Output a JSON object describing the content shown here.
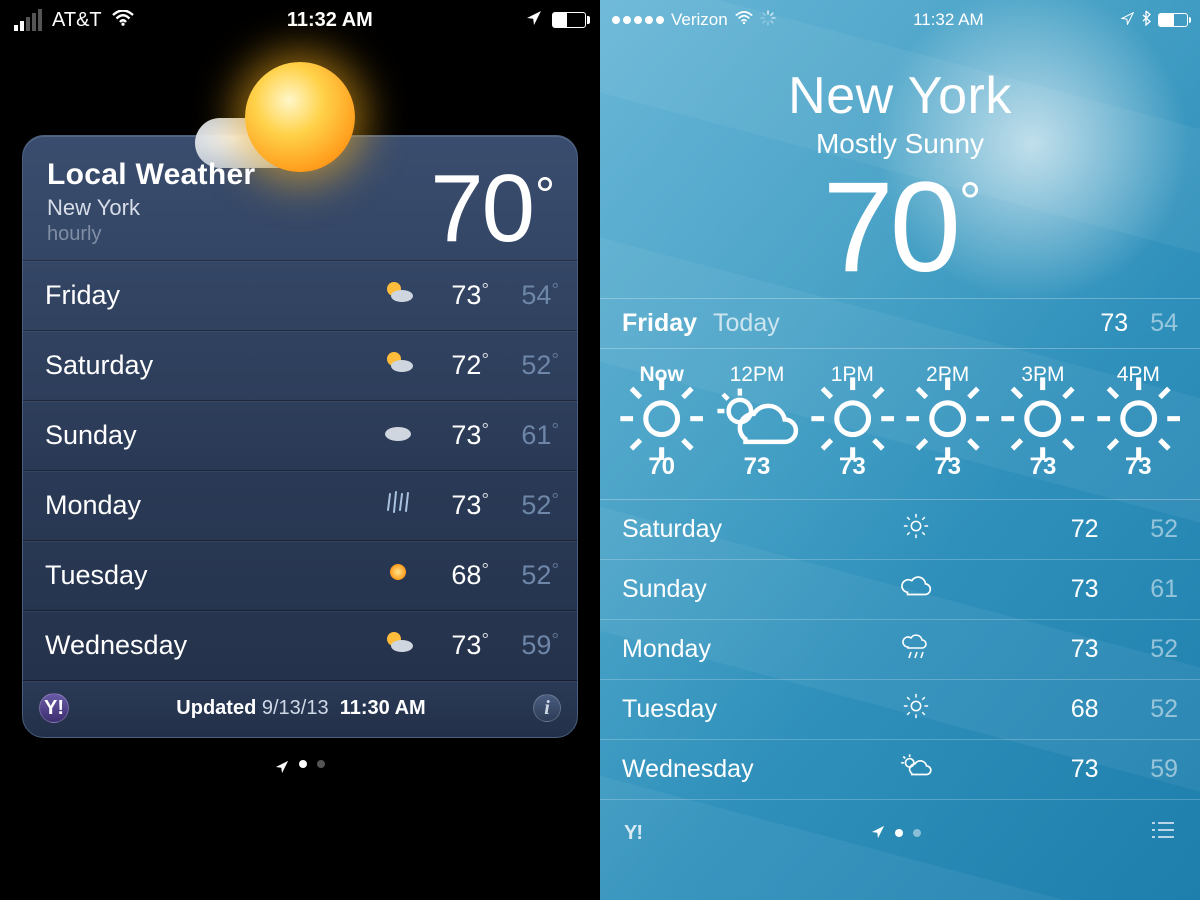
{
  "left": {
    "statusbar": {
      "carrier": "AT&T",
      "time": "11:32 AM"
    },
    "card": {
      "title": "Local Weather",
      "city": "New York",
      "sub": "hourly",
      "temp": "70",
      "icon": "sun-cloud",
      "forecast": [
        {
          "day": "Friday",
          "icon": "sun-cloud",
          "hi": "73",
          "lo": "54"
        },
        {
          "day": "Saturday",
          "icon": "sun-cloud",
          "hi": "72",
          "lo": "52"
        },
        {
          "day": "Sunday",
          "icon": "cloud",
          "hi": "73",
          "lo": "61"
        },
        {
          "day": "Monday",
          "icon": "rain",
          "hi": "73",
          "lo": "52"
        },
        {
          "day": "Tuesday",
          "icon": "sun",
          "hi": "68",
          "lo": "52"
        },
        {
          "day": "Wednesday",
          "icon": "sun-cloud",
          "hi": "73",
          "lo": "59"
        }
      ],
      "footer": {
        "prefix": "Updated",
        "date": "9/13/13",
        "time": "11:30 AM",
        "yahoo": "Y!"
      }
    }
  },
  "right": {
    "statusbar": {
      "carrier": "Verizon",
      "time": "11:32 AM"
    },
    "city": "New York",
    "condition": "Mostly Sunny",
    "temp": "70",
    "today": {
      "day": "Friday",
      "label": "Today",
      "hi": "73",
      "lo": "54"
    },
    "hourly": [
      {
        "time": "Now",
        "icon": "sun",
        "temp": "70"
      },
      {
        "time": "12PM",
        "icon": "sun-cloud",
        "temp": "73"
      },
      {
        "time": "1PM",
        "icon": "sun",
        "temp": "73"
      },
      {
        "time": "2PM",
        "icon": "sun",
        "temp": "73"
      },
      {
        "time": "3PM",
        "icon": "sun",
        "temp": "73"
      },
      {
        "time": "4PM",
        "icon": "sun",
        "temp": "73"
      }
    ],
    "daily": [
      {
        "day": "Saturday",
        "icon": "sun",
        "hi": "72",
        "lo": "52"
      },
      {
        "day": "Sunday",
        "icon": "cloud",
        "hi": "73",
        "lo": "61"
      },
      {
        "day": "Monday",
        "icon": "rain",
        "hi": "73",
        "lo": "52"
      },
      {
        "day": "Tuesday",
        "icon": "sun",
        "hi": "68",
        "lo": "52"
      },
      {
        "day": "Wednesday",
        "icon": "sun-cloud",
        "hi": "73",
        "lo": "59"
      }
    ],
    "footer": {
      "yahoo": "Y!"
    }
  }
}
